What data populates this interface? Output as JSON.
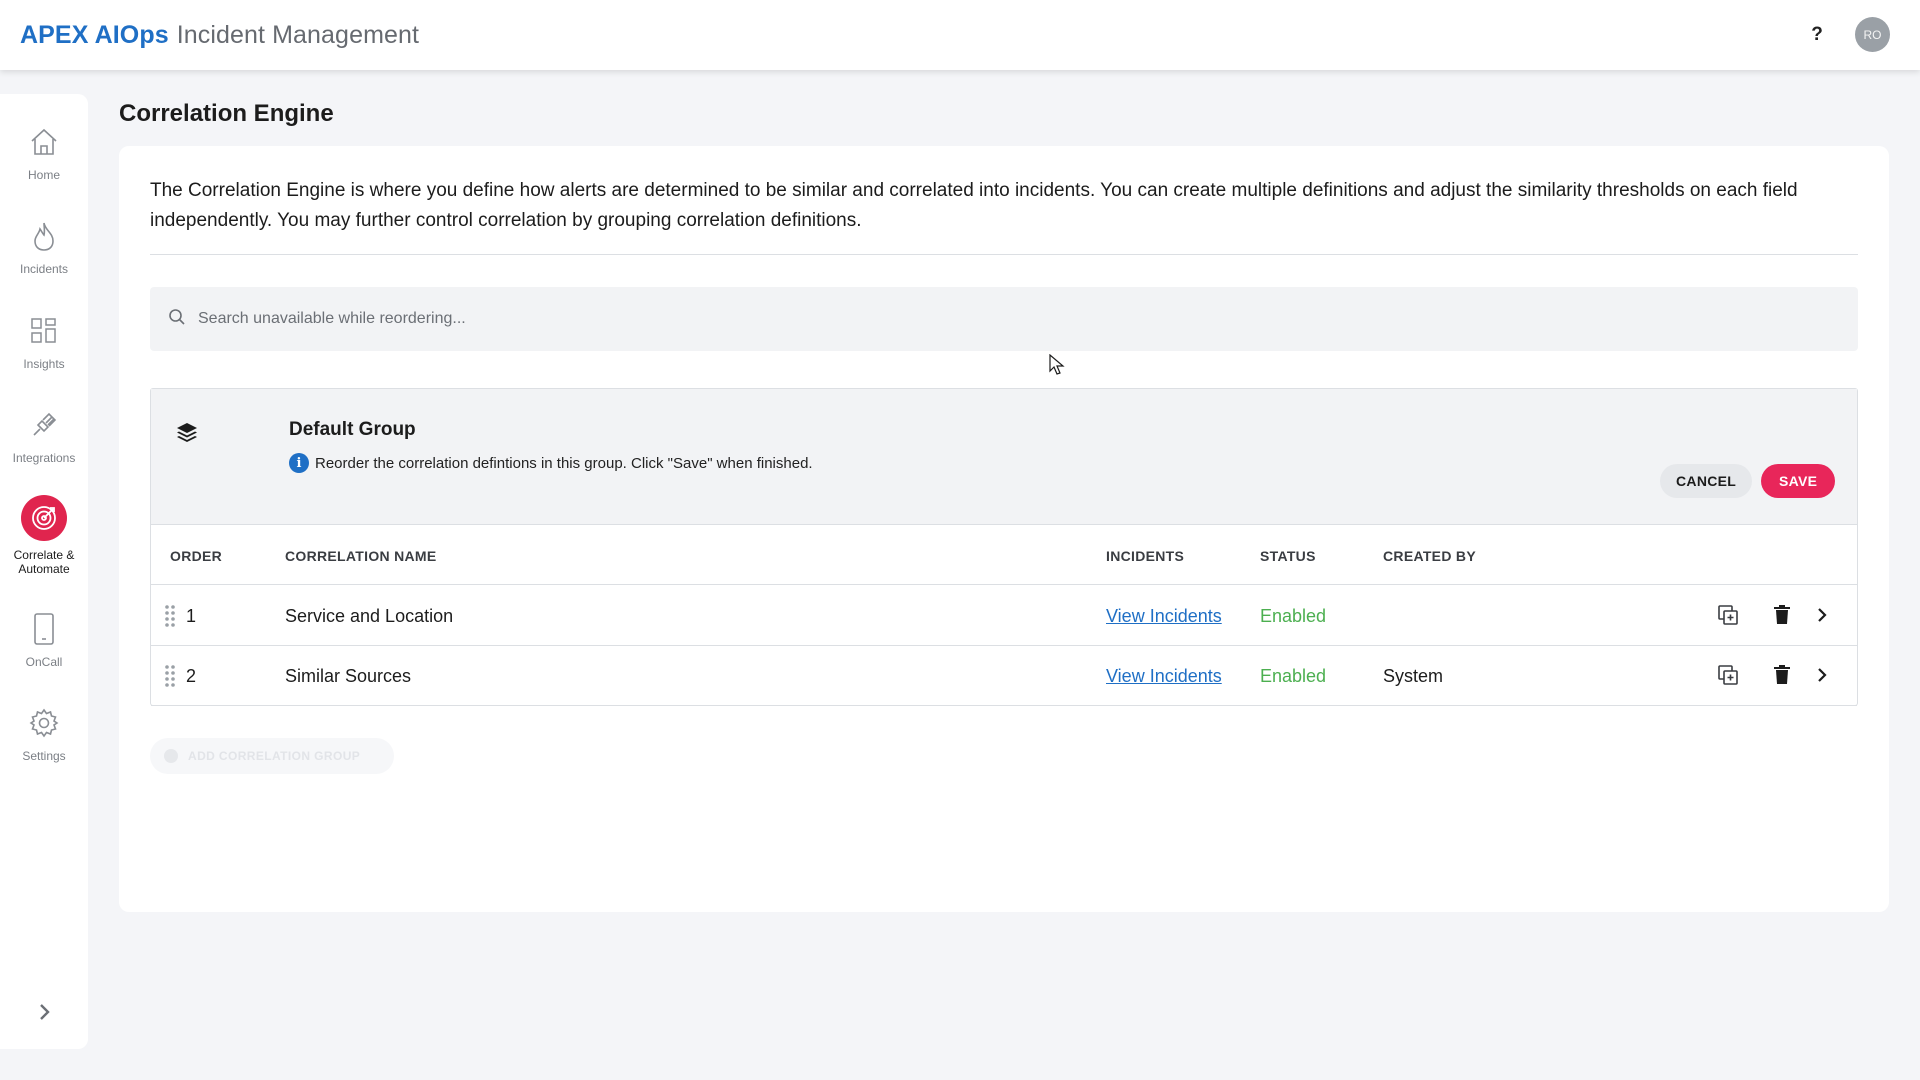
{
  "header": {
    "brand_primary": "APEX AIOps",
    "brand_secondary": "Incident Management",
    "help_label": "?",
    "avatar_initials": "RO"
  },
  "sidebar": {
    "items": [
      {
        "label": "Home",
        "icon": "home-icon"
      },
      {
        "label": "Incidents",
        "icon": "flame-icon"
      },
      {
        "label": "Insights",
        "icon": "grid-icon"
      },
      {
        "label": "Integrations",
        "icon": "plug-icon"
      },
      {
        "label": "Correlate &",
        "label2": "Automate",
        "icon": "target-icon",
        "active": true
      },
      {
        "label": "OnCall",
        "icon": "phone-icon"
      },
      {
        "label": "Settings",
        "icon": "gear-icon"
      }
    ],
    "expand_icon": "chevron-right-icon"
  },
  "page": {
    "title": "Correlation Engine",
    "description": "The Correlation Engine is where you define how alerts are determined to be similar and correlated into incidents. You can create multiple definitions and adjust the similarity thresholds on each field independently. You may further control correlation by grouping correlation definitions.",
    "search_placeholder": "Search unavailable while reordering..."
  },
  "group": {
    "name": "Default Group",
    "note": "Reorder the correlation defintions in this group. Click \"Save\" when finished.",
    "cancel_label": "CANCEL",
    "save_label": "SAVE",
    "columns": [
      "ORDER",
      "CORRELATION NAME",
      "INCIDENTS",
      "STATUS",
      "CREATED BY"
    ],
    "rows": [
      {
        "order": "1",
        "name": "Service and Location",
        "incidents": "View Incidents",
        "status": "Enabled",
        "created_by": ""
      },
      {
        "order": "2",
        "name": "Similar Sources",
        "incidents": "View Incidents",
        "status": "Enabled",
        "created_by": "System"
      }
    ]
  },
  "add_group_label": "ADD CORRELATION GROUP",
  "colors": {
    "brand": "#1f6fc5",
    "accent": "#e8265a",
    "enabled": "#4caf50"
  }
}
